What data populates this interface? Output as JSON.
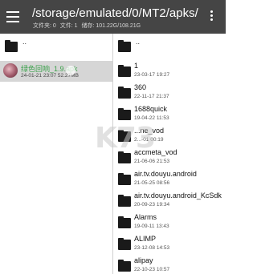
{
  "header": {
    "path": "/storage/emulated/0/MT2/apks/",
    "folders": "文件夹: 0",
    "files": "文件: 1",
    "storage": "储存: 101.22G/108.21G"
  },
  "left_pane": {
    "up_label": "..",
    "selected_file": {
      "name": "绿色回响_1.9.apk",
      "meta": "24-01-21 23:07  52.27MB"
    }
  },
  "right_pane": {
    "up_label": "..",
    "items": [
      {
        "name": "1",
        "date": "23-03-17 19:27"
      },
      {
        "name": "360",
        "date": "22-11-17 21:37"
      },
      {
        "name": "1688quick",
        "date": "19-04-22 11:53"
      },
      {
        "name": "...ne_vod",
        "date": "2...-01 00:19"
      },
      {
        "name": "accmeta_vod",
        "date": "21-06-06 21:53"
      },
      {
        "name": "air.tv.douyu.android",
        "date": "21-05-25 08:56"
      },
      {
        "name": "air.tv.douyu.android_KcSdk",
        "date": "20-09-23 19:34"
      },
      {
        "name": "Alarms",
        "date": "19-09-11 13:43"
      },
      {
        "name": "ALIMP",
        "date": "23-12-08 14:53"
      },
      {
        "name": "alipay",
        "date": "22-10-23 10:57"
      }
    ]
  },
  "watermark": "K73"
}
